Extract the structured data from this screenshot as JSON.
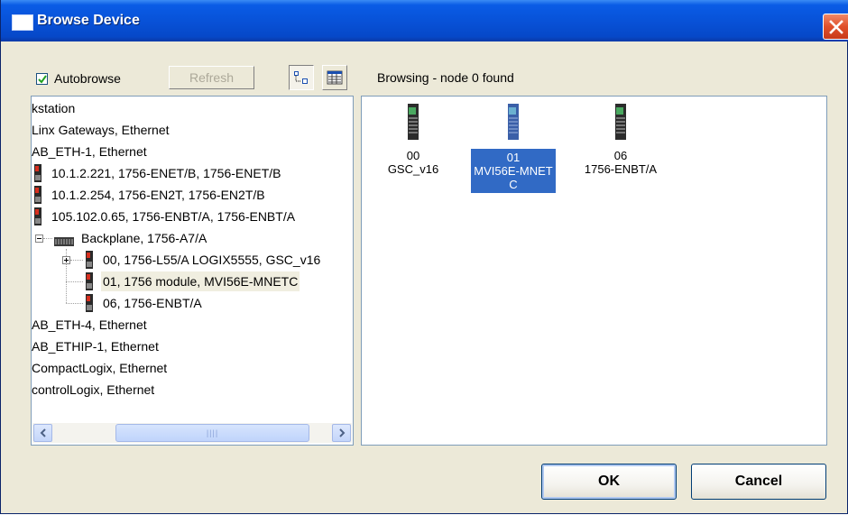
{
  "window": {
    "title": "Browse Device"
  },
  "toolbar": {
    "autobrowse_label": "Autobrowse",
    "autobrowse_checked": true,
    "refresh_label": "Refresh"
  },
  "status": "Browsing - node 0 found",
  "tree": {
    "items": [
      {
        "label": "kstation",
        "icon": "none"
      },
      {
        "label": "Linx Gateways, Ethernet",
        "icon": "none"
      },
      {
        "label": "AB_ETH-1, Ethernet",
        "icon": "none"
      },
      {
        "label": "10.1.2.221, 1756-ENET/B, 1756-ENET/B",
        "icon": "device-icon"
      },
      {
        "label": "10.1.2.254, 1756-EN2T, 1756-EN2T/B",
        "icon": "device-icon"
      },
      {
        "label": "105.102.0.65, 1756-ENBT/A, 1756-ENBT/A",
        "icon": "device-icon"
      },
      {
        "label": "Backplane, 1756-A7/A",
        "icon": "backplane-icon"
      },
      {
        "label": "00, 1756-L55/A LOGIX5555, GSC_v16",
        "icon": "device-icon"
      },
      {
        "label": "01, 1756 module, MVI56E-MNETC",
        "icon": "device-icon",
        "selected": true
      },
      {
        "label": "06, 1756-ENBT/A",
        "icon": "device-icon"
      },
      {
        "label": "AB_ETH-4, Ethernet",
        "icon": "none"
      },
      {
        "label": "AB_ETHIP-1, Ethernet",
        "icon": "none"
      },
      {
        "label": "CompactLogix, Ethernet",
        "icon": "none"
      },
      {
        "label": "controlLogix, Ethernet",
        "icon": "none"
      }
    ]
  },
  "icons": [
    {
      "slot": "00",
      "name": "GSC_v16",
      "selected": false
    },
    {
      "slot": "01",
      "name": "MVI56E-MNET",
      "name2": "C",
      "selected": true
    },
    {
      "slot": "06",
      "name": "1756-ENBT/A",
      "selected": false
    }
  ],
  "buttons": {
    "ok": "OK",
    "cancel": "Cancel"
  },
  "colors": {
    "titlebar": "#0852d8",
    "selection": "#316ac5",
    "dialog_bg": "#ece9d8"
  }
}
